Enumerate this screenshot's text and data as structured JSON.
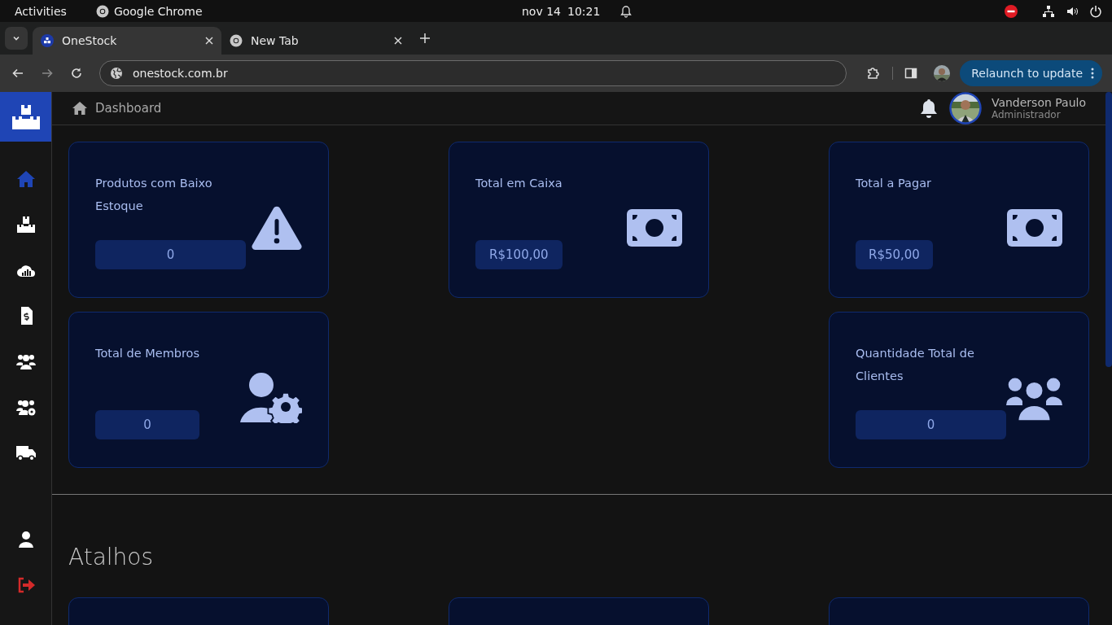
{
  "os_bar": {
    "activities": "Activities",
    "app": "Google Chrome",
    "date": "nov 14",
    "time": "10:21"
  },
  "browser": {
    "tabs": [
      {
        "title": "OneStock",
        "selected": true
      },
      {
        "title": "New Tab",
        "selected": false
      }
    ],
    "url": "onestock.com.br",
    "relaunch": "Relaunch to update"
  },
  "sidebar": {
    "items": [
      {
        "selected": true
      },
      {
        "selected": false
      },
      {
        "selected": false
      },
      {
        "selected": false
      },
      {
        "selected": false
      },
      {
        "selected": false
      },
      {
        "selected": false
      }
    ],
    "bottom_items": [
      {
        "kind": "profile"
      },
      {
        "kind": "logout"
      }
    ]
  },
  "header": {
    "breadcrumb": "Dashboard",
    "user_name": "Vanderson Paulo",
    "user_role": "Administrador"
  },
  "cards": [
    {
      "title": "Produtos com Baixo Estoque",
      "value": "0",
      "kind": "warning"
    },
    {
      "title": "Total em Caixa",
      "value": "R$100,00",
      "kind": "money"
    },
    {
      "title": "Total a Pagar",
      "value": "R$50,00",
      "kind": "money"
    },
    {
      "title": "Total de Membros",
      "value": "0",
      "kind": "member-settings"
    },
    {
      "title": "Quantidade Total de Clientes",
      "value": "0",
      "kind": "group"
    }
  ],
  "shortcuts": {
    "title": "Atalhos"
  }
}
